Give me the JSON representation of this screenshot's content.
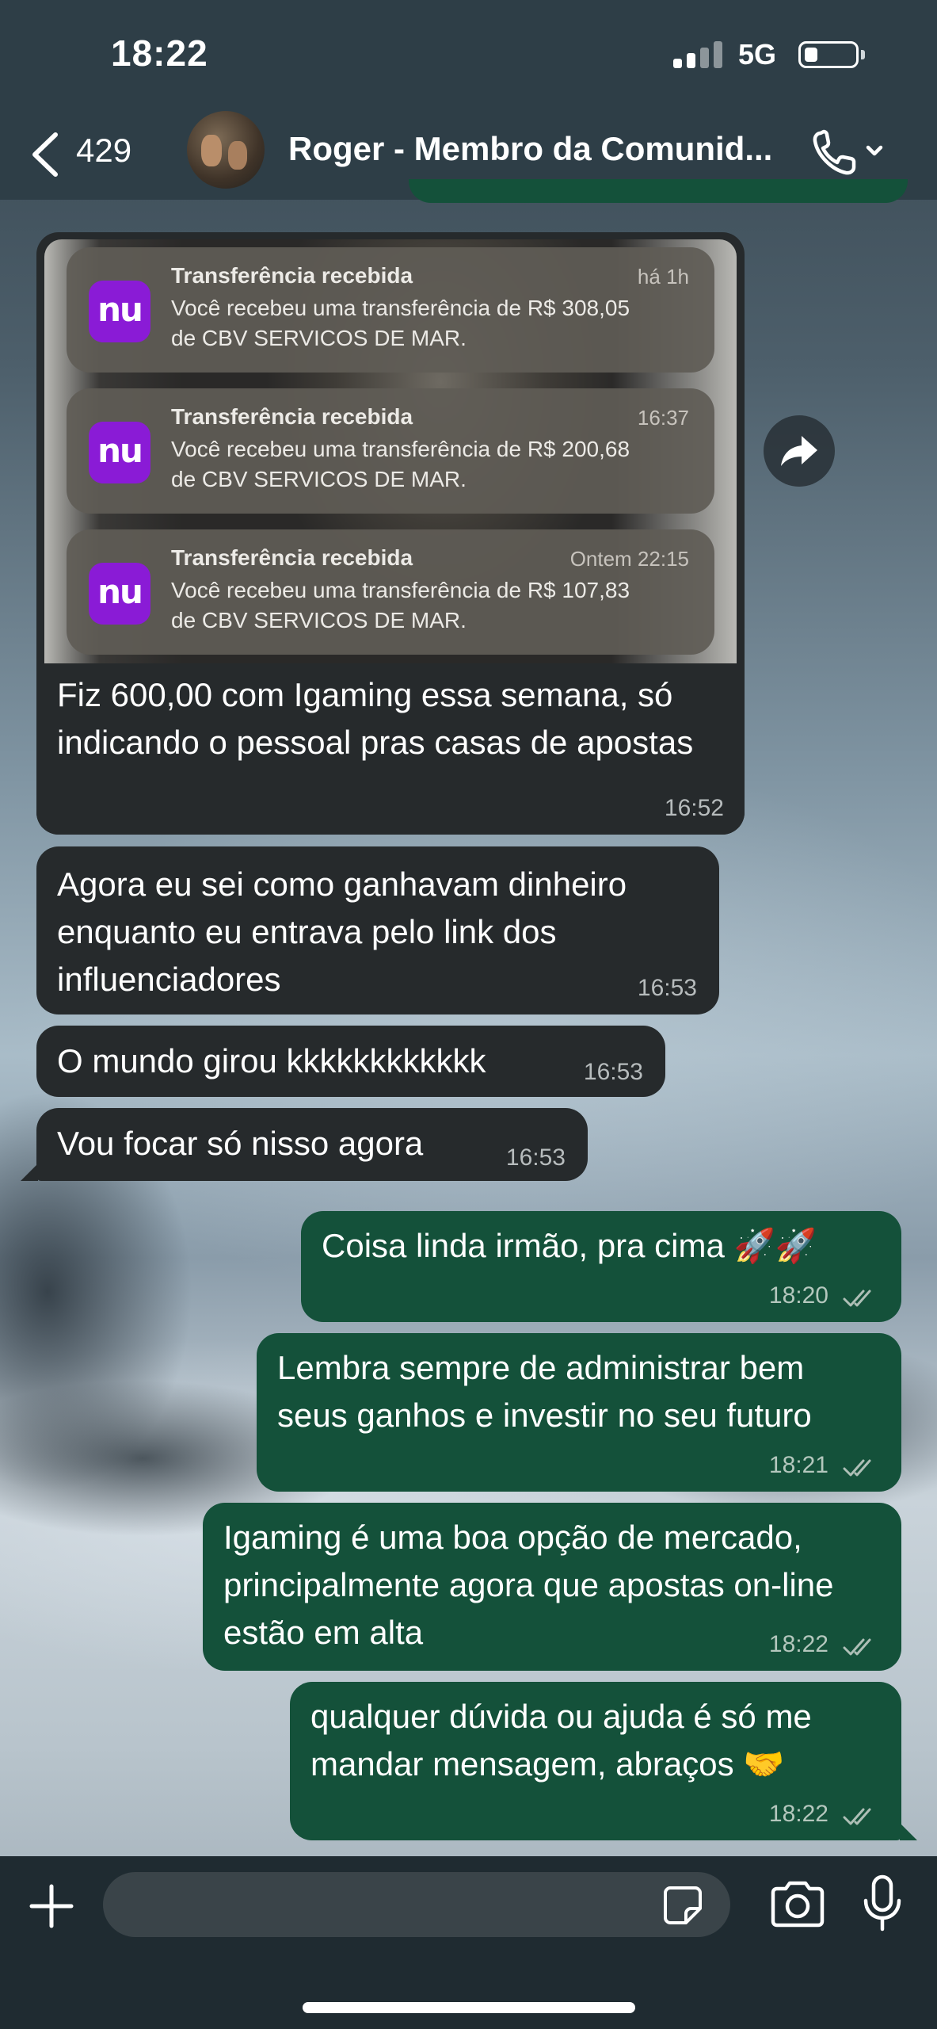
{
  "status_bar": {
    "time": "18:22",
    "network": "5G"
  },
  "header": {
    "back_count": "429",
    "contact_name": "Roger - Membro da Comunid..."
  },
  "image_message": {
    "notifications": [
      {
        "title": "Transferência recebida",
        "time": "há 1h",
        "line1": "Você recebeu uma transferência de R$ 308,05",
        "line2": "de CBV SERVICOS DE MAR.",
        "app_icon_text": "nu"
      },
      {
        "title": "Transferência recebida",
        "time": "16:37",
        "line1": "Você recebeu uma transferência de R$ 200,68",
        "line2": "de CBV SERVICOS DE MAR.",
        "app_icon_text": "nu"
      },
      {
        "title": "Transferência recebida",
        "time": "Ontem 22:15",
        "line1": "Você recebeu uma transferência de R$ 107,83",
        "line2": "de CBV SERVICOS DE MAR.",
        "app_icon_text": "nu"
      }
    ],
    "caption": "Fiz 600,00 com Igaming essa semana, só indicando o pessoal pras casas de apostas",
    "time": "16:52"
  },
  "messages": [
    {
      "direction": "in",
      "text": "Agora eu sei como ganhavam dinheiro enquanto eu entrava pelo link dos influenciadores",
      "time": "16:53"
    },
    {
      "direction": "in",
      "text": "O mundo girou kkkkkkkkkkkk",
      "time": "16:53"
    },
    {
      "direction": "in",
      "text": "Vou focar só nisso agora",
      "time": "16:53"
    },
    {
      "direction": "out",
      "text": "Coisa linda irmão, pra cima 🚀🚀",
      "time": "18:20"
    },
    {
      "direction": "out",
      "text": "Lembra sempre de administrar bem seus ganhos e investir no seu futuro",
      "time": "18:21"
    },
    {
      "direction": "out",
      "text": "Igaming é uma boa opção de mercado, principalmente agora que apostas on-line estão em alta",
      "time": "18:22"
    },
    {
      "direction": "out",
      "text": "qualquer dúvida ou ajuda é só me mandar mensagem, abraços 🤝",
      "time": "18:22"
    }
  ],
  "icons": {
    "back": "chevron-left-icon",
    "call": "phone-icon",
    "forward": "forward-arrow-icon",
    "attach": "plus-icon",
    "sticker": "sticker-icon",
    "camera": "camera-icon",
    "mic": "microphone-icon",
    "read": "double-check-icon"
  },
  "colors": {
    "incoming_bubble": "#262a2c",
    "outgoing_bubble": "#14513a",
    "header_bg": "#2e3e47",
    "nubank_purple": "#8a1bd6"
  }
}
